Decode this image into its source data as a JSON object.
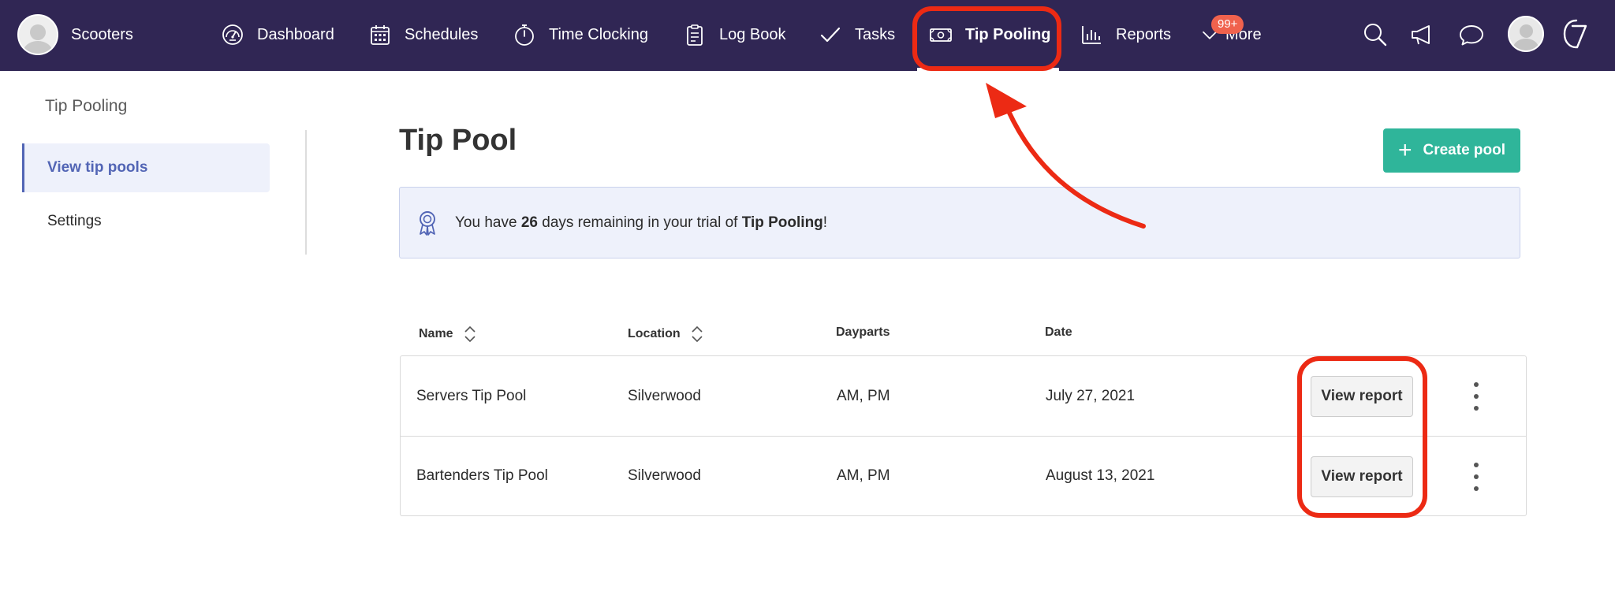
{
  "header": {
    "account_name": "Scooters",
    "nav": [
      {
        "label": "Dashboard",
        "icon": "dashboard-gauge-icon"
      },
      {
        "label": "Schedules",
        "icon": "calendar-icon"
      },
      {
        "label": "Time Clocking",
        "icon": "stopwatch-icon"
      },
      {
        "label": "Log Book",
        "icon": "clipboard-icon"
      },
      {
        "label": "Tasks",
        "icon": "checkmark-icon"
      },
      {
        "label": "Tip Pooling",
        "icon": "money-bill-icon",
        "active": true
      },
      {
        "label": "Reports",
        "icon": "bar-chart-icon"
      },
      {
        "label": "More",
        "icon": "chevron-down-icon"
      }
    ],
    "more_badge": "99+",
    "utility_icons": [
      "search-icon",
      "megaphone-icon",
      "chat-bubble-icon",
      "user-avatar",
      "brand-logo-icon"
    ]
  },
  "sidebar": {
    "title": "Tip Pooling",
    "items": [
      {
        "label": "View tip pools",
        "active": true
      },
      {
        "label": "Settings"
      }
    ]
  },
  "main": {
    "title": "Tip Pool",
    "create_button": "Create pool",
    "trial": {
      "prefix": "You have ",
      "days": "26",
      "middle": " days remaining in your trial of ",
      "product": "Tip Pooling",
      "suffix": "!"
    },
    "table": {
      "columns": [
        "Name",
        "Location",
        "Dayparts",
        "Date"
      ],
      "rows": [
        {
          "name": "Servers Tip Pool",
          "location": "Silverwood",
          "dayparts": "AM, PM",
          "date": "July 27, 2021",
          "action": "View report"
        },
        {
          "name": "Bartenders Tip Pool",
          "location": "Silverwood",
          "dayparts": "AM, PM",
          "date": "August 13, 2021",
          "action": "View report"
        }
      ]
    }
  },
  "colors": {
    "nav_bg": "#302654",
    "accent_teal": "#2fb59a",
    "sidebar_active": "#5265b5",
    "banner_bg": "#eef1fb",
    "badge": "#f0624d",
    "annotation_red": "#ec2a14"
  }
}
